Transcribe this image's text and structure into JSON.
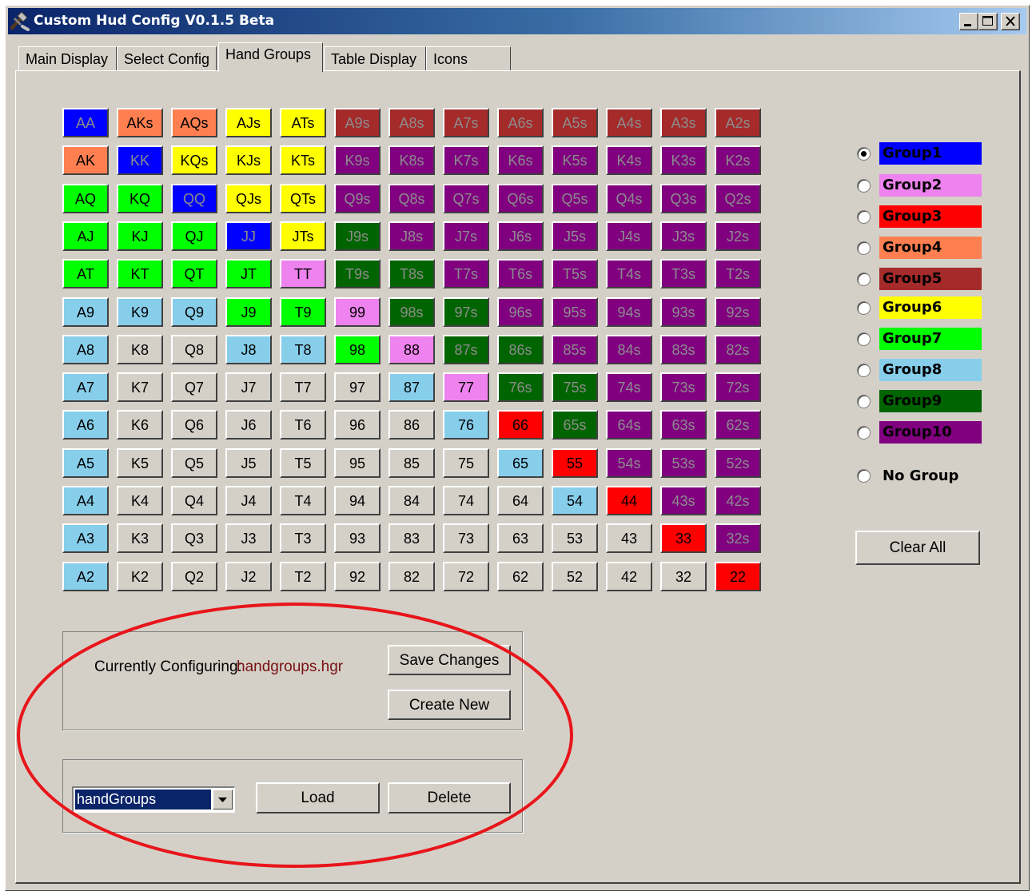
{
  "window": {
    "title": "Custom Hud Config V0.1.5 Beta"
  },
  "tabs": [
    {
      "label": "Main Display",
      "active": false
    },
    {
      "label": "Select Config",
      "active": false
    },
    {
      "label": "Hand Groups",
      "active": true
    },
    {
      "label": "Table Display",
      "active": false
    },
    {
      "label": "Icons",
      "active": false
    }
  ],
  "group_colors": {
    "1": "#0000ff",
    "2": "#ee82ee",
    "3": "#ff0000",
    "4": "#ff7f50",
    "5": "#a52a2a",
    "6": "#ffff00",
    "7": "#00ff00",
    "8": "#87ceeb",
    "9": "#006400",
    "10": "#800080",
    "none": "#d4d0c8"
  },
  "hand_grid": {
    "rows": [
      [
        [
          "AA",
          1
        ],
        [
          "AKs",
          4
        ],
        [
          "AQs",
          4
        ],
        [
          "AJs",
          6
        ],
        [
          "ATs",
          6
        ],
        [
          "A9s",
          5
        ],
        [
          "A8s",
          5
        ],
        [
          "A7s",
          5
        ],
        [
          "A6s",
          5
        ],
        [
          "A5s",
          5
        ],
        [
          "A4s",
          5
        ],
        [
          "A3s",
          5
        ],
        [
          "A2s",
          5
        ]
      ],
      [
        [
          "AK",
          4
        ],
        [
          "KK",
          1
        ],
        [
          "KQs",
          6
        ],
        [
          "KJs",
          6
        ],
        [
          "KTs",
          6
        ],
        [
          "K9s",
          10
        ],
        [
          "K8s",
          10
        ],
        [
          "K7s",
          10
        ],
        [
          "K6s",
          10
        ],
        [
          "K5s",
          10
        ],
        [
          "K4s",
          10
        ],
        [
          "K3s",
          10
        ],
        [
          "K2s",
          10
        ]
      ],
      [
        [
          "AQ",
          7
        ],
        [
          "KQ",
          7
        ],
        [
          "QQ",
          1
        ],
        [
          "QJs",
          6
        ],
        [
          "QTs",
          6
        ],
        [
          "Q9s",
          10
        ],
        [
          "Q8s",
          10
        ],
        [
          "Q7s",
          10
        ],
        [
          "Q6s",
          10
        ],
        [
          "Q5s",
          10
        ],
        [
          "Q4s",
          10
        ],
        [
          "Q3s",
          10
        ],
        [
          "Q2s",
          10
        ]
      ],
      [
        [
          "AJ",
          7
        ],
        [
          "KJ",
          7
        ],
        [
          "QJ",
          7
        ],
        [
          "JJ",
          1
        ],
        [
          "JTs",
          6
        ],
        [
          "J9s",
          9
        ],
        [
          "J8s",
          10
        ],
        [
          "J7s",
          10
        ],
        [
          "J6s",
          10
        ],
        [
          "J5s",
          10
        ],
        [
          "J4s",
          10
        ],
        [
          "J3s",
          10
        ],
        [
          "J2s",
          10
        ]
      ],
      [
        [
          "AT",
          7
        ],
        [
          "KT",
          7
        ],
        [
          "QT",
          7
        ],
        [
          "JT",
          7
        ],
        [
          "TT",
          2
        ],
        [
          "T9s",
          9
        ],
        [
          "T8s",
          9
        ],
        [
          "T7s",
          10
        ],
        [
          "T6s",
          10
        ],
        [
          "T5s",
          10
        ],
        [
          "T4s",
          10
        ],
        [
          "T3s",
          10
        ],
        [
          "T2s",
          10
        ]
      ],
      [
        [
          "A9",
          8
        ],
        [
          "K9",
          8
        ],
        [
          "Q9",
          8
        ],
        [
          "J9",
          7
        ],
        [
          "T9",
          7
        ],
        [
          "99",
          2
        ],
        [
          "98s",
          9
        ],
        [
          "97s",
          9
        ],
        [
          "96s",
          10
        ],
        [
          "95s",
          10
        ],
        [
          "94s",
          10
        ],
        [
          "93s",
          10
        ],
        [
          "92s",
          10
        ]
      ],
      [
        [
          "A8",
          8
        ],
        [
          "K8",
          0
        ],
        [
          "Q8",
          0
        ],
        [
          "J8",
          8
        ],
        [
          "T8",
          8
        ],
        [
          "98",
          7
        ],
        [
          "88",
          2
        ],
        [
          "87s",
          9
        ],
        [
          "86s",
          9
        ],
        [
          "85s",
          10
        ],
        [
          "84s",
          10
        ],
        [
          "83s",
          10
        ],
        [
          "82s",
          10
        ]
      ],
      [
        [
          "A7",
          8
        ],
        [
          "K7",
          0
        ],
        [
          "Q7",
          0
        ],
        [
          "J7",
          0
        ],
        [
          "T7",
          0
        ],
        [
          "97",
          0
        ],
        [
          "87",
          8
        ],
        [
          "77",
          2
        ],
        [
          "76s",
          9
        ],
        [
          "75s",
          9
        ],
        [
          "74s",
          10
        ],
        [
          "73s",
          10
        ],
        [
          "72s",
          10
        ]
      ],
      [
        [
          "A6",
          8
        ],
        [
          "K6",
          0
        ],
        [
          "Q6",
          0
        ],
        [
          "J6",
          0
        ],
        [
          "T6",
          0
        ],
        [
          "96",
          0
        ],
        [
          "86",
          0
        ],
        [
          "76",
          8
        ],
        [
          "66",
          3
        ],
        [
          "65s",
          9
        ],
        [
          "64s",
          10
        ],
        [
          "63s",
          10
        ],
        [
          "62s",
          10
        ]
      ],
      [
        [
          "A5",
          8
        ],
        [
          "K5",
          0
        ],
        [
          "Q5",
          0
        ],
        [
          "J5",
          0
        ],
        [
          "T5",
          0
        ],
        [
          "95",
          0
        ],
        [
          "85",
          0
        ],
        [
          "75",
          0
        ],
        [
          "65",
          8
        ],
        [
          "55",
          3
        ],
        [
          "54s",
          10
        ],
        [
          "53s",
          10
        ],
        [
          "52s",
          10
        ]
      ],
      [
        [
          "A4",
          8
        ],
        [
          "K4",
          0
        ],
        [
          "Q4",
          0
        ],
        [
          "J4",
          0
        ],
        [
          "T4",
          0
        ],
        [
          "94",
          0
        ],
        [
          "84",
          0
        ],
        [
          "74",
          0
        ],
        [
          "64",
          0
        ],
        [
          "54",
          8
        ],
        [
          "44",
          3
        ],
        [
          "43s",
          10
        ],
        [
          "42s",
          10
        ]
      ],
      [
        [
          "A3",
          8
        ],
        [
          "K3",
          0
        ],
        [
          "Q3",
          0
        ],
        [
          "J3",
          0
        ],
        [
          "T3",
          0
        ],
        [
          "93",
          0
        ],
        [
          "83",
          0
        ],
        [
          "73",
          0
        ],
        [
          "63",
          0
        ],
        [
          "53",
          0
        ],
        [
          "43",
          0
        ],
        [
          "33",
          3
        ],
        [
          "32s",
          10
        ]
      ],
      [
        [
          "A2",
          8
        ],
        [
          "K2",
          0
        ],
        [
          "Q2",
          0
        ],
        [
          "J2",
          0
        ],
        [
          "T2",
          0
        ],
        [
          "92",
          0
        ],
        [
          "82",
          0
        ],
        [
          "72",
          0
        ],
        [
          "62",
          0
        ],
        [
          "52",
          0
        ],
        [
          "42",
          0
        ],
        [
          "32",
          0
        ],
        [
          "22",
          3
        ]
      ]
    ]
  },
  "groups": [
    {
      "label": "Group1",
      "color": "#0000ff",
      "text_color": "#000000",
      "selected": true
    },
    {
      "label": "Group2",
      "color": "#ee82ee",
      "text_color": "#000000",
      "selected": false
    },
    {
      "label": "Group3",
      "color": "#ff0000",
      "text_color": "#000000",
      "selected": false
    },
    {
      "label": "Group4",
      "color": "#ff7f50",
      "text_color": "#000000",
      "selected": false
    },
    {
      "label": "Group5",
      "color": "#a52a2a",
      "text_color": "#000000",
      "selected": false
    },
    {
      "label": "Group6",
      "color": "#ffff00",
      "text_color": "#000000",
      "selected": false
    },
    {
      "label": "Group7",
      "color": "#00ff00",
      "text_color": "#000000",
      "selected": false
    },
    {
      "label": "Group8",
      "color": "#87ceeb",
      "text_color": "#000000",
      "selected": false
    },
    {
      "label": "Group9",
      "color": "#006400",
      "text_color": "#000000",
      "selected": false
    },
    {
      "label": "Group10",
      "color": "#800080",
      "text_color": "#000000",
      "selected": false
    }
  ],
  "no_group_label": "No Group",
  "clear_all_label": "Clear All",
  "config": {
    "currently_label": "Currently Configuring:",
    "current_file": "handgroups.hgr",
    "save_label": "Save Changes",
    "create_label": "Create New"
  },
  "loader": {
    "selected": "handGroups",
    "load_label": "Load",
    "delete_label": "Delete"
  },
  "annotation_color": "#e8151b"
}
